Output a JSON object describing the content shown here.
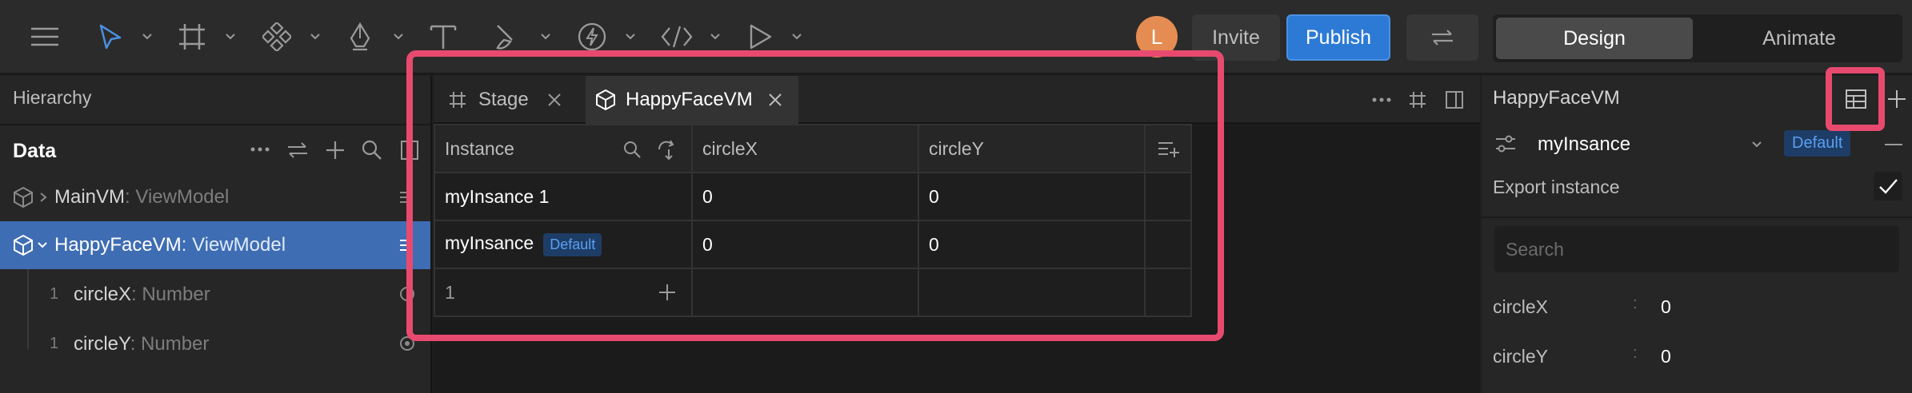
{
  "toolbar": {
    "avatar_initial": "L",
    "invite_label": "Invite",
    "publish_label": "Publish",
    "mode_design": "Design",
    "mode_animate": "Animate",
    "accent": "#2d7ad6"
  },
  "left_panel": {
    "title": "Hierarchy",
    "data_title": "Data",
    "tree": [
      {
        "name": "MainVM",
        "type": ": ViewModel"
      },
      {
        "name": "HappyFaceVM",
        "type": ": ViewModel"
      },
      {
        "index": "1",
        "name": "circleX",
        "type": ": Number"
      },
      {
        "index": "1",
        "name": "circleY",
        "type": ": Number"
      }
    ]
  },
  "center": {
    "tabs": [
      {
        "label": "Stage",
        "icon": "hash-icon"
      },
      {
        "label": "HappyFaceVM",
        "icon": "cube-icon"
      }
    ],
    "table": {
      "headers": [
        "Instance",
        "circleX",
        "circleY"
      ],
      "rows": [
        {
          "instance": "myInsance 1",
          "badge": "",
          "circleX": "0",
          "circleY": "0"
        },
        {
          "instance": "myInsance",
          "badge": "Default",
          "circleX": "0",
          "circleY": "0"
        }
      ],
      "footer_count": "1"
    }
  },
  "right_panel": {
    "title": "HappyFaceVM",
    "instance_name": "myInsance",
    "instance_badge": "Default",
    "export_label": "Export instance",
    "search_placeholder": "Search",
    "properties": [
      {
        "label": "circleX",
        "value": "0"
      },
      {
        "label": "circleY",
        "value": "0"
      }
    ]
  },
  "highlight_color": "#e84a6f"
}
